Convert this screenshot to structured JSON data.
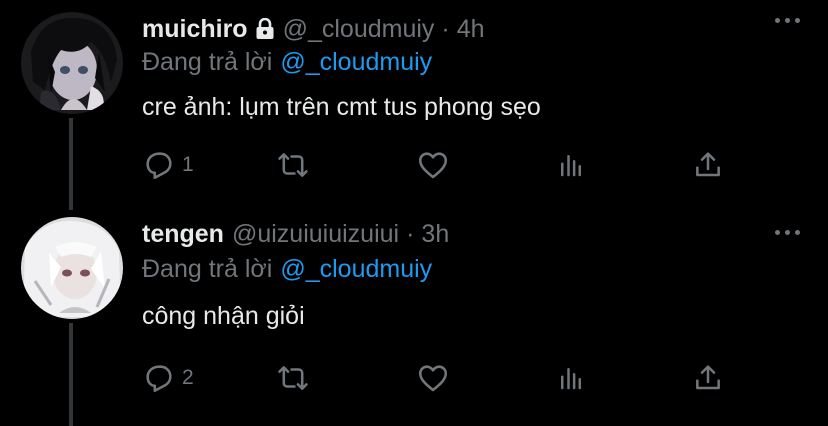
{
  "tweets": [
    {
      "name": "muichiro",
      "handle": "@_cloudmuiy",
      "separator": "·",
      "time": "4h",
      "protected": true,
      "replying_prefix": "Đang trả lời",
      "replying_to": "@_cloudmuiy",
      "text": "cre ảnh: lụm trên cmt tus phong sẹo",
      "reply_count": "1",
      "avatar_icon": "dark-haired-anime-avatar"
    },
    {
      "name": "tengen",
      "handle": "@uizuiuiuizuiui",
      "separator": "·",
      "time": "3h",
      "protected": false,
      "replying_prefix": "Đang trả lời",
      "replying_to": "@_cloudmuiy",
      "text": "công nhận giỏi",
      "reply_count": "2",
      "avatar_icon": "white-haired-anime-avatar"
    }
  ],
  "colors": {
    "background": "#000000",
    "text": "#e7e9ea",
    "muted": "#71767b",
    "link": "#1d9bf0"
  }
}
